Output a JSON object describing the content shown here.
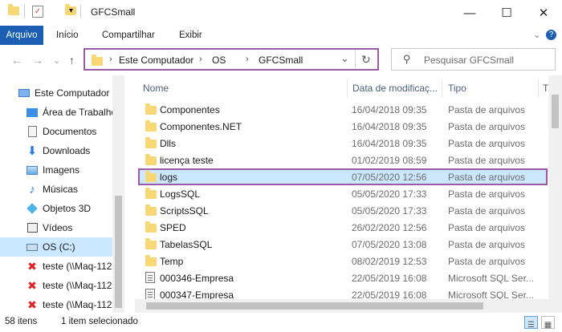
{
  "window": {
    "title": "GFCSmall",
    "minimize": "—",
    "maximize": "☐",
    "close": "✕"
  },
  "ribbon": {
    "tabs": [
      "Arquivo",
      "Início",
      "Compartilhar",
      "Exibir"
    ],
    "expand_icon": "⌄",
    "help_icon": "?"
  },
  "nav": {
    "back": "←",
    "forward": "→",
    "recent": "⌄",
    "up": "↑",
    "address": [
      "Este Computador",
      "OS",
      "GFCSmall"
    ],
    "address_sep": "›",
    "dropdown": "⌄",
    "refresh": "↻",
    "search_icon": "⚲",
    "search_placeholder": "Pesquisar GFCSmall"
  },
  "sidebar": {
    "items": [
      {
        "label": "Este Computador",
        "icon": "computer-icon"
      },
      {
        "label": "Área de Trabalho",
        "icon": "desktop-icon"
      },
      {
        "label": "Documentos",
        "icon": "documents-icon"
      },
      {
        "label": "Downloads",
        "icon": "downloads-icon"
      },
      {
        "label": "Imagens",
        "icon": "pictures-icon"
      },
      {
        "label": "Músicas",
        "icon": "music-icon"
      },
      {
        "label": "Objetos 3D",
        "icon": "objects3d-icon"
      },
      {
        "label": "Vídeos",
        "icon": "videos-icon"
      },
      {
        "label": "OS (C:)",
        "icon": "drive-icon"
      },
      {
        "label": "teste (\\\\Maq-112",
        "icon": "network-drive-icon"
      },
      {
        "label": "teste (\\\\Maq-112",
        "icon": "network-drive-icon"
      },
      {
        "label": "teste (\\\\Maq-112",
        "icon": "network-drive-icon"
      }
    ]
  },
  "columns": {
    "name": "Nome",
    "date": "Data de modificaç...",
    "type": "Tipo",
    "size": "T"
  },
  "files": [
    {
      "name": "Componentes",
      "date": "16/04/2018 09:35",
      "type": "Pasta de arquivos",
      "icon": "folder"
    },
    {
      "name": "Componentes.NET",
      "date": "16/04/2018 09:35",
      "type": "Pasta de arquivos",
      "icon": "folder"
    },
    {
      "name": "Dlls",
      "date": "16/04/2018 09:35",
      "type": "Pasta de arquivos",
      "icon": "folder"
    },
    {
      "name": "licença teste",
      "date": "01/02/2019 08:59",
      "type": "Pasta de arquivos",
      "icon": "folder"
    },
    {
      "name": "logs",
      "date": "07/05/2020 12:56",
      "type": "Pasta de arquivos",
      "icon": "folder",
      "selected": true
    },
    {
      "name": "LogsSQL",
      "date": "05/05/2020 17:33",
      "type": "Pasta de arquivos",
      "icon": "folder"
    },
    {
      "name": "ScriptsSQL",
      "date": "05/05/2020 17:33",
      "type": "Pasta de arquivos",
      "icon": "folder"
    },
    {
      "name": "SPED",
      "date": "26/02/2020 12:56",
      "type": "Pasta de arquivos",
      "icon": "folder"
    },
    {
      "name": "TabelasSQL",
      "date": "07/05/2020 13:08",
      "type": "Pasta de arquivos",
      "icon": "folder"
    },
    {
      "name": "Temp",
      "date": "08/02/2019 12:53",
      "type": "Pasta de arquivos",
      "icon": "folder"
    },
    {
      "name": "000346-Empresa",
      "date": "22/05/2019 16:08",
      "type": "Microsoft SQL Ser...",
      "icon": "sql-file"
    },
    {
      "name": "000347-Empresa",
      "date": "22/05/2019 16:08",
      "type": "Microsoft SQL Ser...",
      "icon": "sql-file"
    }
  ],
  "status": {
    "count": "58 itens",
    "selection": "1 item selecionado"
  },
  "colors": {
    "accent": "#1a5fb4",
    "highlight": "#9b5aa8",
    "selection": "#cce8ff",
    "folder": "#f8d775"
  }
}
